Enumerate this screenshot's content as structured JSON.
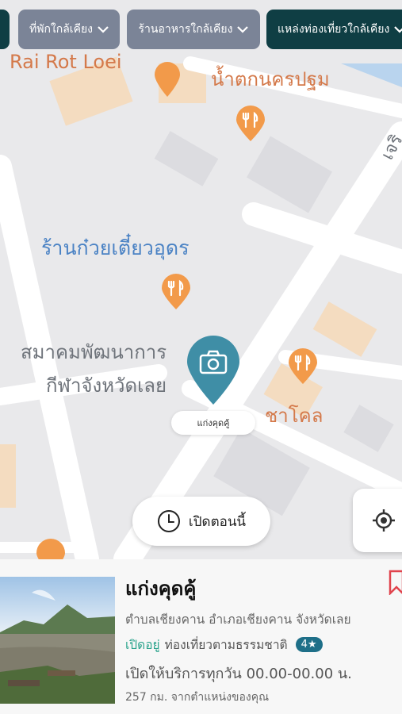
{
  "filters": [
    {
      "label": "ที่พักใกล้เคียง",
      "style": "gray"
    },
    {
      "label": "ร้านอาหารใกล้เคียง",
      "style": "gray"
    },
    {
      "label": "แหล่งท่องเที่ยวใกล้เคียง",
      "style": "dark"
    }
  ],
  "map": {
    "labels": {
      "top_partial": "Rai Rot Loei",
      "waterfall": "น้ำตกนครปฐม",
      "noodle_shop": "ร้านก๋วยเตี๋ยวอุดร",
      "sports_assoc_line1": "สมาคมพัฒนาการ",
      "sports_assoc_line2": "กีฬาจังหวัดเลย",
      "cha_khon": "ชาโคล",
      "road_name": "เจริ"
    },
    "selected_place_tag": "แก่งคุดคู้",
    "open_now_button": "เปิดตอนนี้"
  },
  "card": {
    "title": "แก่งคุดคู้",
    "address": "ตำบลเชียงคาน อำเภอเชียงคาน จังหวัดเลย",
    "status": "เปิดอยู่",
    "category": "ท่องเที่ยวตามธรรมชาติ",
    "rating": "4★",
    "hours": "เปิดให้บริการทุกวัน 00.00-00.00 น.",
    "distance": "257 กม. จากตำแหน่งของคุณ"
  },
  "colors": {
    "accent_dark": "#0f3e44",
    "chip_gray": "#7b8497",
    "pin_orange": "#f29a4a",
    "camera_pin": "#3f8ea6",
    "open_green": "#2aa38c"
  }
}
